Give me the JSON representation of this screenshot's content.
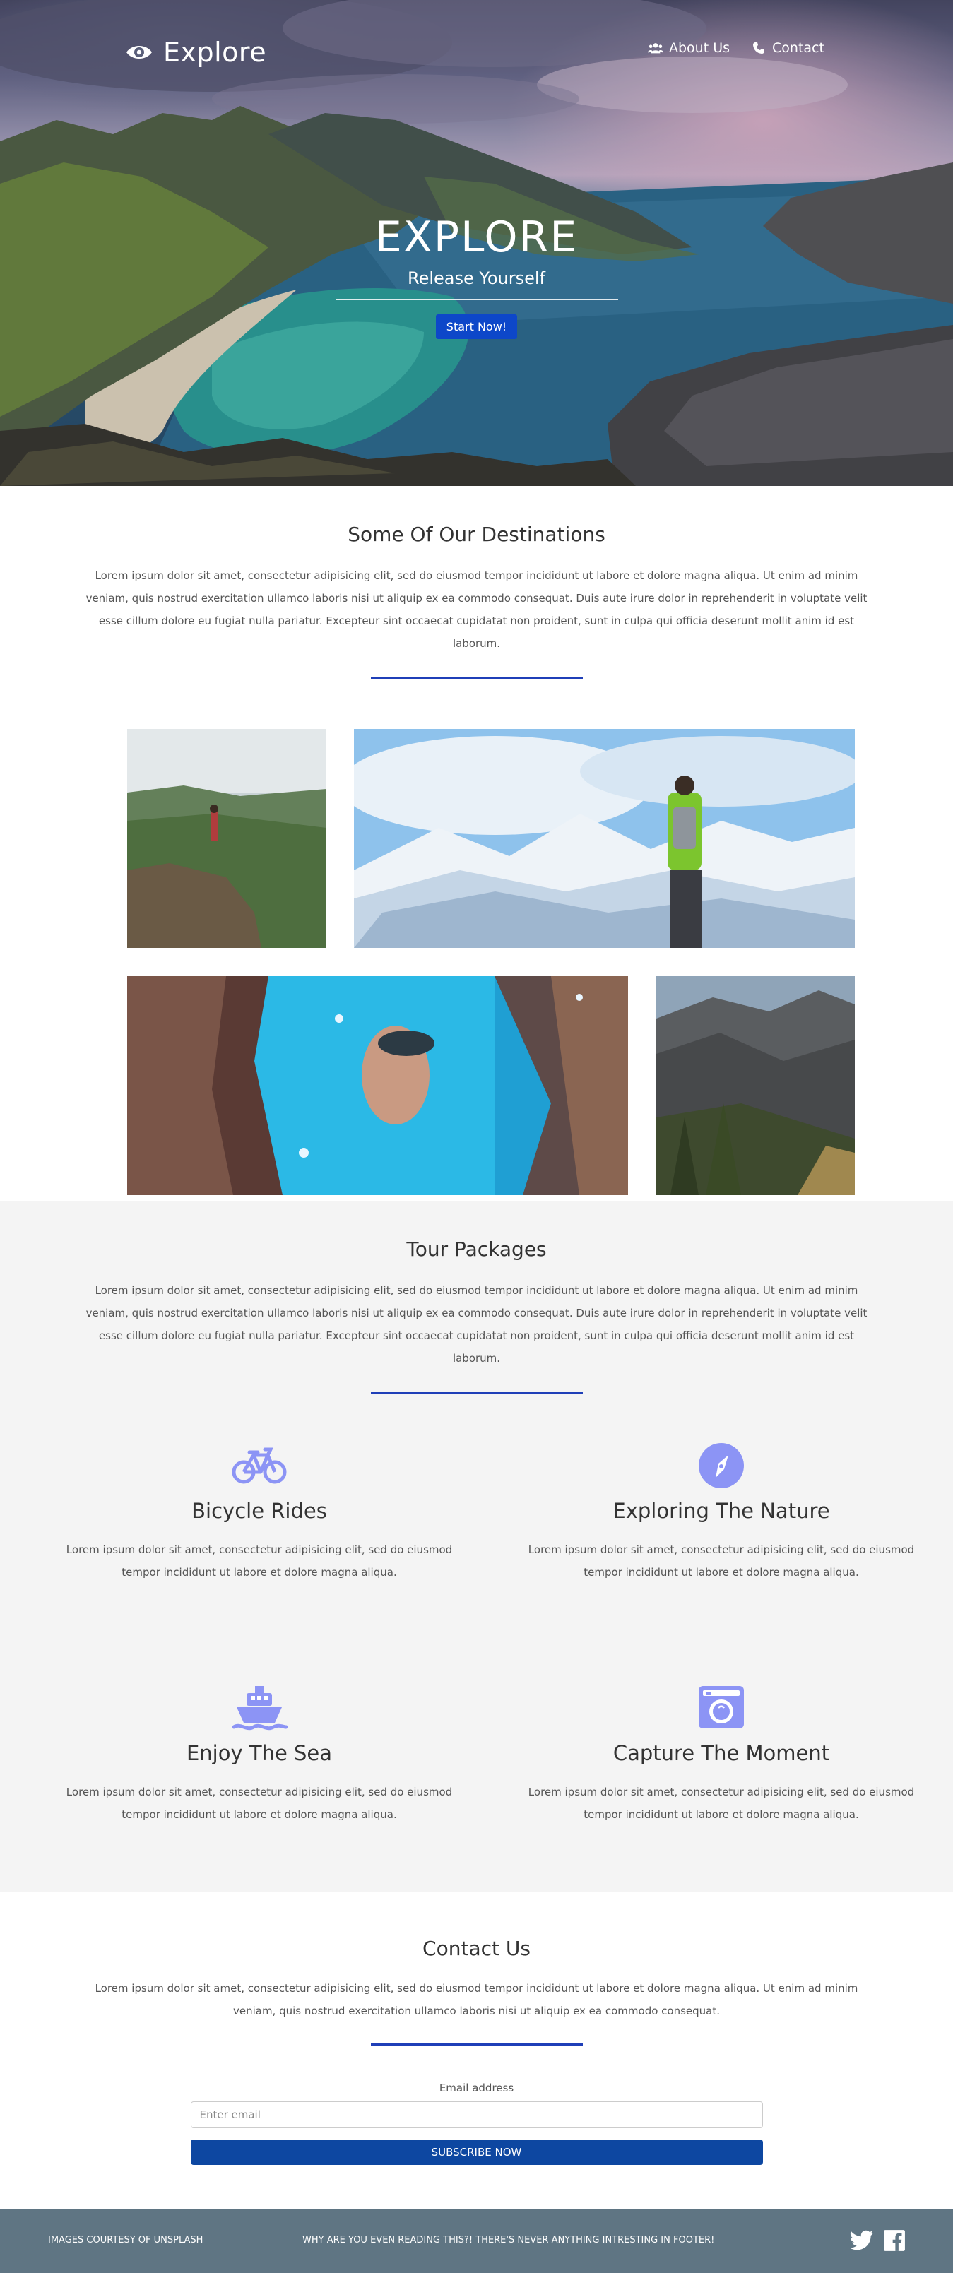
{
  "nav": {
    "brand": "Explore",
    "links": [
      {
        "label": "About Us",
        "icon": "users-icon"
      },
      {
        "label": "Contact",
        "icon": "phone-icon"
      }
    ]
  },
  "hero": {
    "title": "EXPLORE",
    "subtitle": "Release Yourself",
    "button": "Start Now!"
  },
  "destinations": {
    "title": "Some Of Our Destinations",
    "text": "Lorem ipsum dolor sit amet, consectetur adipisicing elit, sed do eiusmod tempor incididunt ut labore et dolore magna aliqua. Ut enim ad minim veniam, quis nostrud exercitation ullamco laboris nisi ut aliquip ex ea commodo consequat. Duis aute irure dolor in reprehenderit in voluptate velit esse cillum dolore eu fugiat nulla pariatur. Excepteur sint occaecat cupidatat non proident, sunt in culpa qui officia deserunt mollit anim id est laborum."
  },
  "packages": {
    "title": "Tour Packages",
    "text": "Lorem ipsum dolor sit amet, consectetur adipisicing elit, sed do eiusmod tempor incididunt ut labore et dolore magna aliqua. Ut enim ad minim veniam, quis nostrud exercitation ullamco laboris nisi ut aliquip ex ea commodo consequat. Duis aute irure dolor in reprehenderit in voluptate velit esse cillum dolore eu fugiat nulla pariatur. Excepteur sint occaecat cupidatat non proident, sunt in culpa qui officia deserunt mollit anim id est laborum.",
    "items": [
      {
        "title": "Bicycle Rides",
        "icon": "bicycle-icon",
        "text": "Lorem ipsum dolor sit amet, consectetur adipisicing elit, sed do eiusmod tempor incididunt ut labore et dolore magna aliqua."
      },
      {
        "title": "Exploring The Nature",
        "icon": "compass-icon",
        "text": "Lorem ipsum dolor sit amet, consectetur adipisicing elit, sed do eiusmod tempor incididunt ut labore et dolore magna aliqua."
      },
      {
        "title": "Enjoy The Sea",
        "icon": "ship-icon",
        "text": "Lorem ipsum dolor sit amet, consectetur adipisicing elit, sed do eiusmod tempor incididunt ut labore et dolore magna aliqua."
      },
      {
        "title": "Capture The Moment",
        "icon": "camera-icon",
        "text": "Lorem ipsum dolor sit amet, consectetur adipisicing elit, sed do eiusmod tempor incididunt ut labore et dolore magna aliqua."
      }
    ]
  },
  "contact": {
    "title": "Contact Us",
    "text": "Lorem ipsum dolor sit amet, consectetur adipisicing elit, sed do eiusmod tempor incididunt ut labore et dolore magna aliqua. Ut enim ad minim veniam, quis nostrud exercitation ullamco laboris nisi ut aliquip ex ea commodo consequat.",
    "email_label": "Email address",
    "email_placeholder": "Enter email",
    "button": "SUBSCRIBE NOW"
  },
  "footer": {
    "credit": "IMAGES COURTESY OF UNSPLASH",
    "quip": "WHY ARE YOU EVEN READING THIS?! THERE'S NEVER ANYTHING INTRESTING IN FOOTER!",
    "social": [
      "twitter-icon",
      "facebook-icon"
    ]
  },
  "colors": {
    "accent": "#1f3fb8",
    "button": "#0d47a1",
    "icon": "#8c94f5",
    "footer": "#5f7583",
    "section_alt": "#f4f4f4"
  }
}
